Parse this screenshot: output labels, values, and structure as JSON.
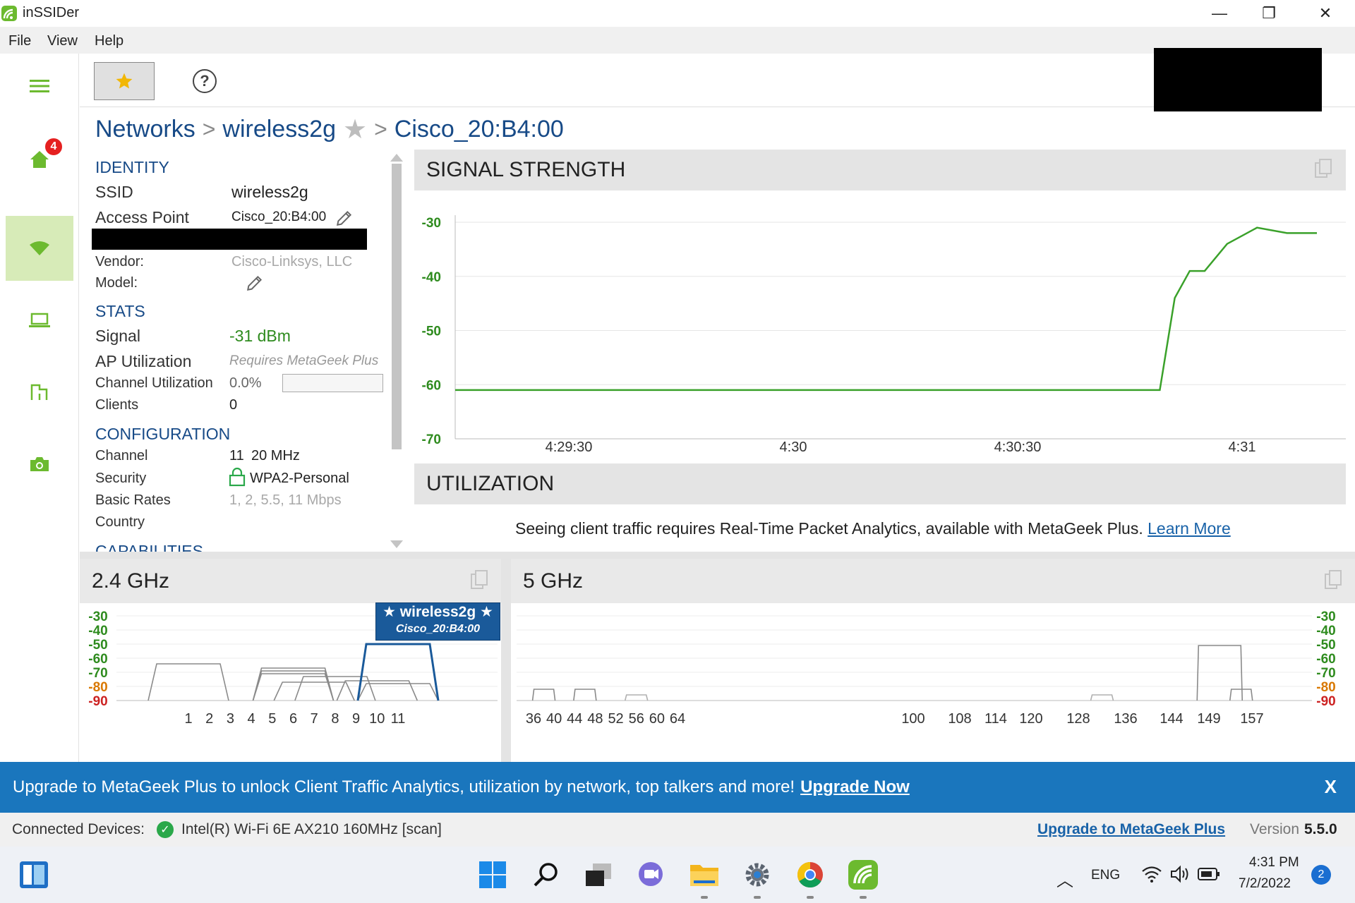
{
  "window": {
    "title": "inSSIDer",
    "minimize_glyph": "—",
    "maximize_glyph": "❐",
    "close_glyph": "✕"
  },
  "menu": {
    "items": [
      "File",
      "View",
      "Help"
    ]
  },
  "nav": {
    "items": [
      {
        "icon": "menu-icon",
        "active": false
      },
      {
        "icon": "home-icon",
        "active": false,
        "badge": "4"
      },
      {
        "icon": "wifi-icon",
        "active": true
      },
      {
        "icon": "laptop-icon",
        "active": false
      },
      {
        "icon": "floorplan-icon",
        "active": false
      },
      {
        "icon": "camera-icon",
        "active": false
      }
    ],
    "accent": "#6cba2f"
  },
  "toolbar": {
    "favorite_icon": "star-icon",
    "help_glyph": "?"
  },
  "breadcrumb": {
    "root": "Networks",
    "network": "wireless2g",
    "ap": "Cisco_20:B4:00"
  },
  "details": {
    "identity": {
      "title": "IDENTITY",
      "ssid_label": "SSID",
      "ssid_value": "wireless2g",
      "ap_label": "Access Point",
      "ap_value": "Cisco_20:B4:00",
      "vendor_label": "Vendor:",
      "vendor_value": "Cisco-Linksys, LLC",
      "model_label": "Model:"
    },
    "stats": {
      "title": "STATS",
      "signal_label": "Signal",
      "signal_value": "-31 dBm",
      "ap_util_label": "AP Utilization",
      "ap_util_value": "Requires MetaGeek Plus",
      "chan_util_label": "Channel Utilization",
      "chan_util_value": "0.0%",
      "chan_util_fraction": 0,
      "clients_label": "Clients",
      "clients_value": "0"
    },
    "configuration": {
      "title": "CONFIGURATION",
      "channel_label": "Channel",
      "channel_value": "11",
      "width_value": "20 MHz",
      "security_label": "Security",
      "security_value": "WPA2-Personal",
      "rates_label": "Basic Rates",
      "rates_value": "1, 2, 5.5, 11 Mbps",
      "country_label": "Country"
    },
    "capabilities": {
      "title": "CAPABILITIES"
    }
  },
  "signal": {
    "title": "SIGNAL STRENGTH"
  },
  "utilization": {
    "title": "UTILIZATION",
    "message": "Seeing client traffic requires Real-Time Packet Analytics, available with MetaGeek Plus.",
    "link": "Learn More"
  },
  "bands": {
    "b24": {
      "title": "2.4 GHz"
    },
    "b5": {
      "title": "5 GHz"
    },
    "highlight": {
      "ssid": "★ wireless2g ★",
      "ap": "Cisco_20:B4:00"
    }
  },
  "chart_data": [
    {
      "type": "line",
      "title": "SIGNAL STRENGTH",
      "x_ticks": [
        "4:29:30",
        "4:30",
        "4:30:30",
        "4:31"
      ],
      "ylim": [
        -70,
        -30
      ],
      "y_ticks": [
        -30,
        -40,
        -50,
        -60,
        -70
      ],
      "series": [
        {
          "color": "#3aa12a",
          "points": [
            [
              "4:29:00",
              -61
            ],
            [
              "4:30:49",
              -61
            ],
            [
              "4:30:51",
              -44
            ],
            [
              "4:30:53",
              -39
            ],
            [
              "4:30:55",
              -39
            ],
            [
              "4:30:58",
              -34
            ],
            [
              "4:31:02",
              -31
            ],
            [
              "4:31:06",
              -32
            ],
            [
              "4:31:10",
              -32
            ]
          ]
        }
      ],
      "grid": true
    },
    {
      "type": "line",
      "title": "2.4 GHz",
      "categories": [
        "1",
        "2",
        "3",
        "4",
        "5",
        "6",
        "7",
        "8",
        "9",
        "10",
        "11"
      ],
      "ylim": [
        -90,
        -30
      ],
      "y_ticks": [
        -30,
        -40,
        -50,
        -60,
        -70,
        -80,
        -90
      ],
      "y_tick_colors": {
        "-30": "#2e8b1e",
        "-40": "#2e8b1e",
        "-50": "#2e8b1e",
        "-60": "#2e8b1e",
        "-70": "#2e8b1e",
        "-80": "#d97800",
        "-90": "#cc2222"
      },
      "series": [
        {
          "channel": 1,
          "level": -64,
          "color": "#8a8a8a",
          "highlight": false
        },
        {
          "channel": 6,
          "level": -67,
          "color": "#8a8a8a",
          "highlight": false
        },
        {
          "channel": 6,
          "level": -69,
          "color": "#8a8a8a",
          "highlight": false
        },
        {
          "channel": 6,
          "level": -71,
          "color": "#8a8a8a",
          "highlight": false
        },
        {
          "channel": 8,
          "level": -73,
          "color": "#8a8a8a",
          "highlight": false
        },
        {
          "channel": 7,
          "level": -77,
          "color": "#8a8a8a",
          "highlight": false
        },
        {
          "channel": 10,
          "level": -76,
          "color": "#8a8a8a",
          "highlight": false
        },
        {
          "channel": 11,
          "level": -78,
          "color": "#8a8a8a",
          "highlight": false
        },
        {
          "channel": 11,
          "level": -50,
          "color": "#1a5a9a",
          "highlight": true
        }
      ]
    },
    {
      "type": "line",
      "title": "5 GHz",
      "categories": [
        "36",
        "40",
        "44",
        "48",
        "52",
        "56",
        "60",
        "64",
        "100",
        "108",
        "114",
        "120",
        "128",
        "136",
        "144",
        "149",
        "157"
      ],
      "ylim": [
        -90,
        -30
      ],
      "y_ticks": [
        -30,
        -40,
        -50,
        -60,
        -70,
        -80,
        -90
      ],
      "series": [
        {
          "channel": 38,
          "level": -82,
          "color": "#8a8a8a"
        },
        {
          "channel": 46,
          "level": -82,
          "color": "#8a8a8a"
        },
        {
          "channel": 56,
          "level": -86,
          "color": "#b0b0b0"
        },
        {
          "channel": 132,
          "level": -86,
          "color": "#b0b0b0"
        },
        {
          "channel": 151,
          "level": -51,
          "color": "#8a8a8a"
        },
        {
          "channel": 155,
          "level": -82,
          "color": "#8a8a8a"
        }
      ]
    }
  ],
  "banner": {
    "text": "Upgrade to MetaGeek Plus to unlock Client Traffic Analytics, utilization by network, top talkers and more!",
    "link": "Upgrade Now",
    "close": "X"
  },
  "status": {
    "connected_label": "Connected Devices:",
    "device": "Intel(R) Wi-Fi 6E AX210 160MHz [scan]",
    "upgrade_link": "Upgrade to MetaGeek Plus",
    "version_label": "Version",
    "version_value": "5.5.0"
  },
  "taskbar": {
    "lang": "ENG",
    "time": "4:31 PM",
    "date": "7/2/2022",
    "notifications": "2"
  }
}
